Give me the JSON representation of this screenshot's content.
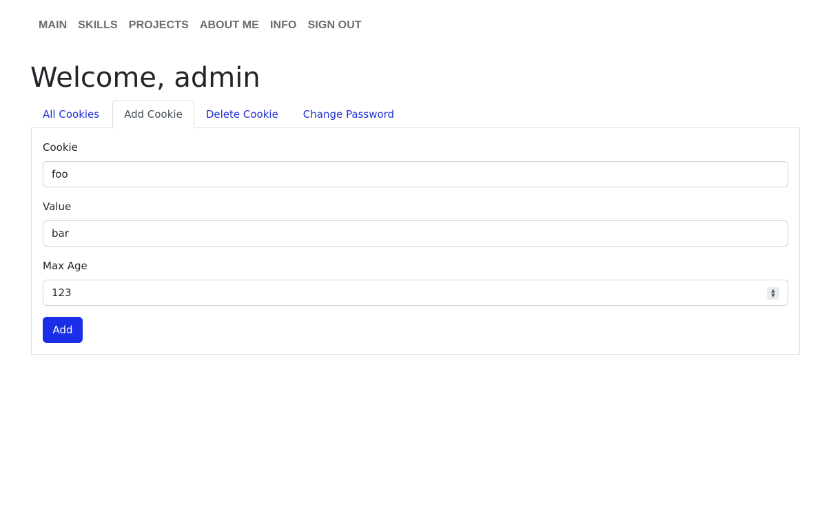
{
  "nav": {
    "items": [
      {
        "label": "MAIN"
      },
      {
        "label": "SKILLS"
      },
      {
        "label": "PROJECTS"
      },
      {
        "label": "ABOUT ME"
      },
      {
        "label": "INFO"
      },
      {
        "label": "SIGN OUT"
      }
    ]
  },
  "page": {
    "title": "Welcome, admin"
  },
  "tabs": [
    {
      "label": "All Cookies",
      "active": false
    },
    {
      "label": "Add Cookie",
      "active": true
    },
    {
      "label": "Delete Cookie",
      "active": false
    },
    {
      "label": "Change Password",
      "active": false
    }
  ],
  "form": {
    "cookie": {
      "label": "Cookie",
      "value": "foo"
    },
    "value": {
      "label": "Value",
      "value": "bar"
    },
    "max_age": {
      "label": "Max Age",
      "value": "123"
    },
    "submit_label": "Add"
  },
  "colors": {
    "accent": "#1a2ee8",
    "link": "#1f2fd6",
    "nav_text": "#6c6c6c"
  }
}
